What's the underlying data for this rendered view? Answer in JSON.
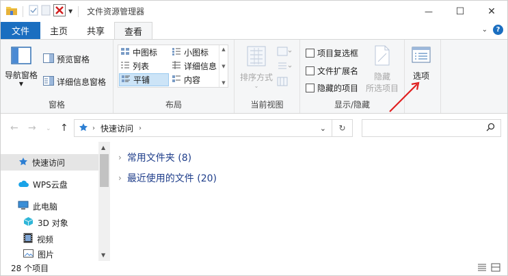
{
  "window": {
    "title": "文件资源管理器",
    "minimize_glyph": "—",
    "maximize_glyph": "☐",
    "close_glyph": "✕"
  },
  "ribbon_tabs": {
    "file": "文件",
    "home": "主页",
    "share": "共享",
    "view": "查看",
    "help_glyph": "?"
  },
  "panes_group": {
    "label": "窗格",
    "nav_pane": "导航窗格",
    "preview_pane": "预览窗格",
    "details_pane": "详细信息窗格"
  },
  "layout_group": {
    "label": "布局",
    "items": [
      "中图标",
      "小图标",
      "列表",
      "详细信息",
      "平铺",
      "内容"
    ]
  },
  "current_view_group": {
    "label": "当前视图",
    "sort_by": "排序方式"
  },
  "show_hide_group": {
    "label": "显示/隐藏",
    "item_checkboxes": "项目复选框",
    "file_extensions": "文件扩展名",
    "hidden_items": "隐藏的项目",
    "hide_selected_line1": "隐藏",
    "hide_selected_line2": "所选项目"
  },
  "options": {
    "label": "选项"
  },
  "address": {
    "path": "快速访问"
  },
  "sidebar": {
    "items": [
      "快速访问",
      "WPS云盘",
      "此电脑",
      "3D 对象",
      "视频",
      "图片"
    ]
  },
  "content": {
    "groups": [
      "常用文件夹 (8)",
      "最近使用的文件 (20)"
    ]
  },
  "status": {
    "item_count": "28 个项目"
  },
  "colors": {
    "accent": "#1a6ec0",
    "annotation_arrow": "#e02020",
    "group_heading": "#1e3d8a"
  }
}
